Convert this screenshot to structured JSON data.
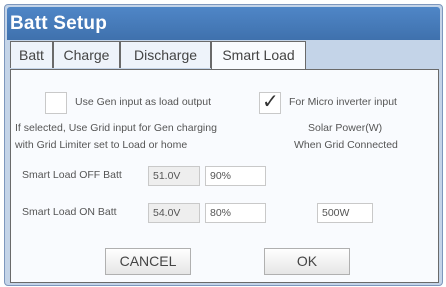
{
  "window": {
    "title": "Batt Setup"
  },
  "tabs": [
    {
      "label": "Batt"
    },
    {
      "label": "Charge"
    },
    {
      "label": "Discharge"
    },
    {
      "label": "Smart Load"
    }
  ],
  "options": {
    "use_gen_input": {
      "label": "Use Gen input as load output",
      "checked": false
    },
    "micro_inverter": {
      "label": "For Micro inverter input",
      "checked": true,
      "mark": "✓"
    }
  },
  "notes": {
    "line1_left": "If selected, Use Grid input for Gen charging",
    "line1_right": "Solar Power(W)",
    "line2_left": "with Grid Limiter set to Load or home",
    "line2_right": "When Grid Connected"
  },
  "smart_load_off": {
    "label": "Smart Load OFF Batt",
    "voltage": "51.0V",
    "percent": "90%"
  },
  "smart_load_on": {
    "label": "Smart Load ON Batt",
    "voltage": "54.0V",
    "percent": "80%",
    "power": "500W"
  },
  "buttons": {
    "cancel": "CANCEL",
    "ok": "OK"
  }
}
